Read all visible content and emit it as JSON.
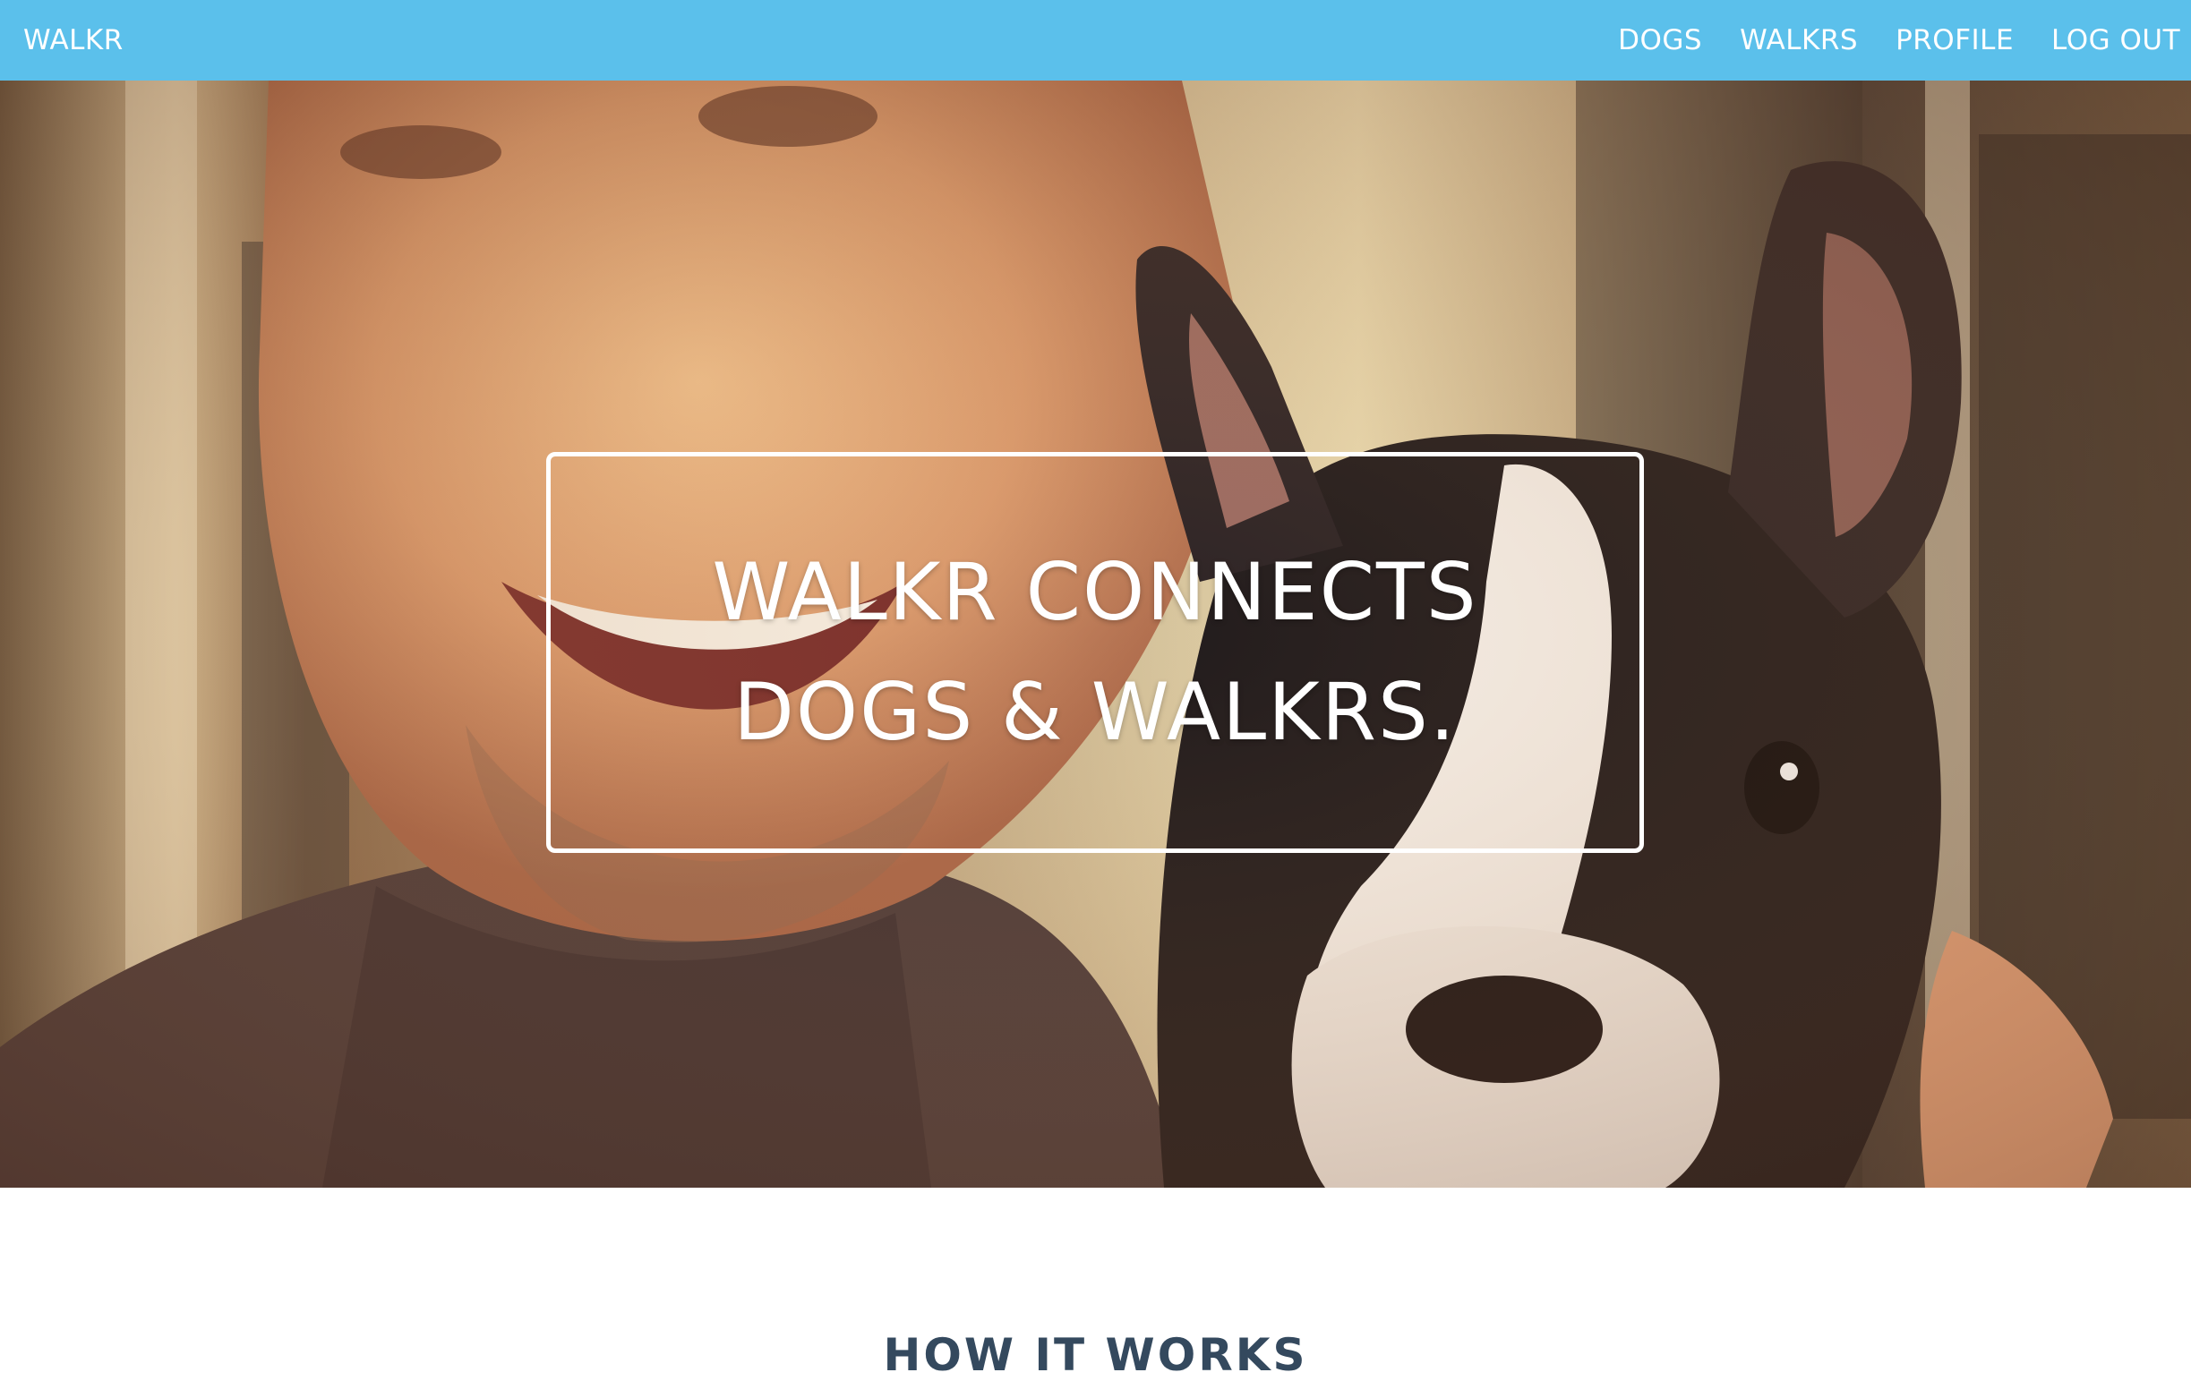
{
  "navbar": {
    "brand": "WALKR",
    "links": [
      {
        "label": "DOGS"
      },
      {
        "label": "WALKRS"
      },
      {
        "label": "PROFILE"
      },
      {
        "label": "LOG OUT"
      }
    ],
    "background_color": "#5bc0eb"
  },
  "hero": {
    "line1": "WALKR CONNECTS",
    "line2": "DOGS & WALKRS."
  },
  "section": {
    "heading": "HOW IT WORKS"
  }
}
